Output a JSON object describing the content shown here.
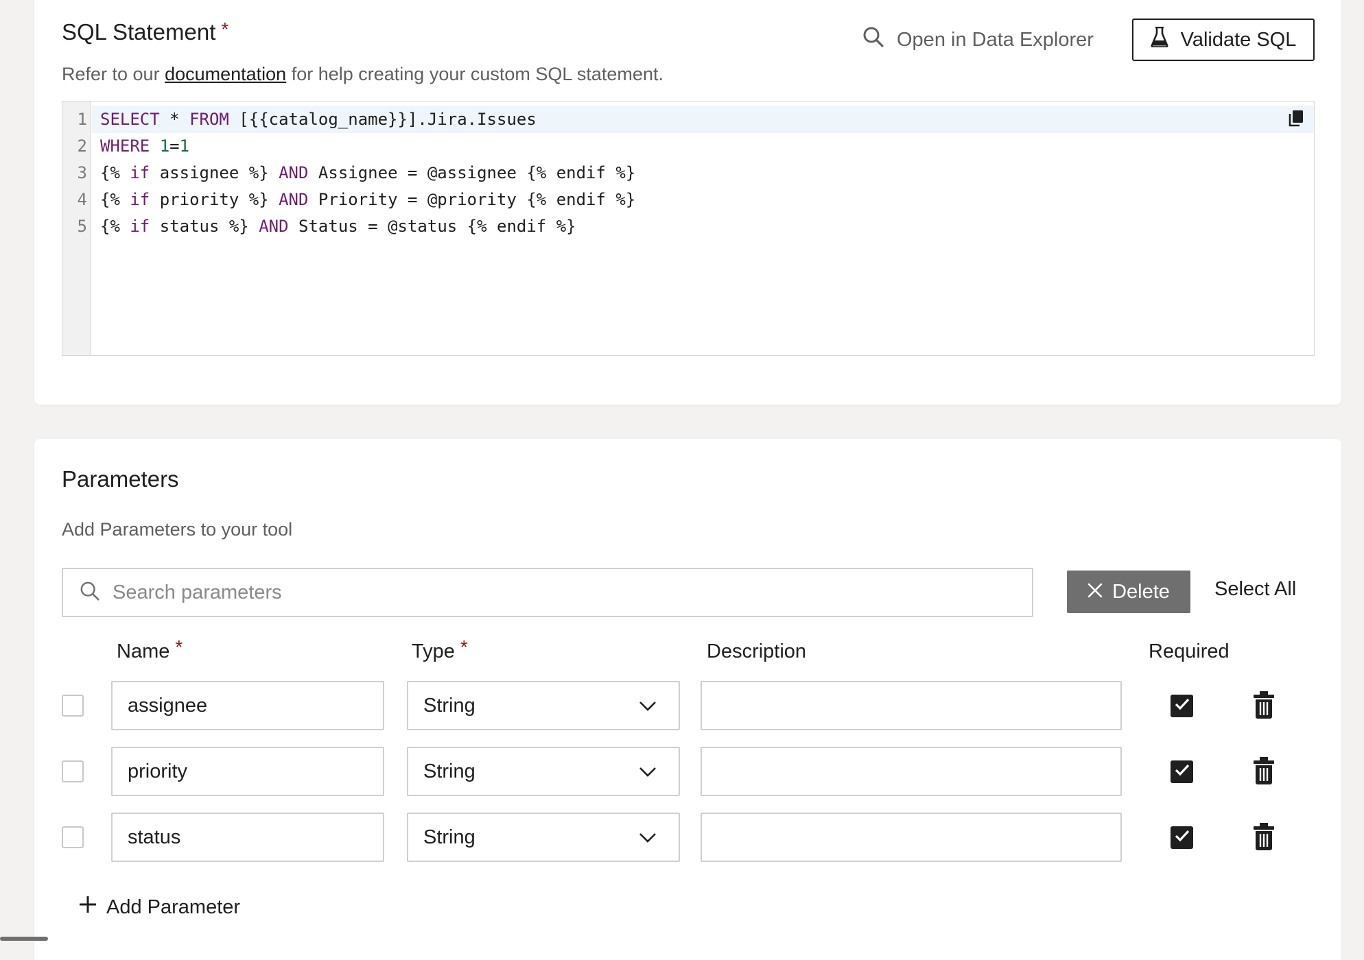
{
  "sql_section": {
    "title": "SQL Statement",
    "required_marker": "*",
    "subtitle_prefix": "Refer to our ",
    "subtitle_link": "documentation",
    "subtitle_suffix": " for help creating your custom SQL statement.",
    "open_explorer_label": "Open in Data Explorer",
    "validate_label": "Validate SQL",
    "line_numbers": [
      "1",
      "2",
      "3",
      "4",
      "5"
    ],
    "code_lines": [
      "SELECT * FROM [{{catalog_name}}].Jira.Issues",
      "WHERE 1=1",
      "{% if assignee %} AND Assignee = @assignee {% endif %}",
      "{% if priority %} AND Priority = @priority {% endif %}",
      "{% if status %} AND Status = @status {% endif %}"
    ]
  },
  "params_section": {
    "title": "Parameters",
    "subtitle": "Add Parameters to your tool",
    "search_placeholder": "Search parameters",
    "delete_label": "Delete",
    "select_all_label": "Select All",
    "columns": {
      "name": "Name",
      "type": "Type",
      "description": "Description",
      "required": "Required",
      "required_marker": "*"
    },
    "rows": [
      {
        "name": "assignee",
        "type": "String",
        "description": "",
        "required": true,
        "selected": false
      },
      {
        "name": "priority",
        "type": "String",
        "description": "",
        "required": true,
        "selected": false
      },
      {
        "name": "status",
        "type": "String",
        "description": "",
        "required": true,
        "selected": false
      }
    ],
    "add_label": "Add Parameter"
  },
  "colors": {
    "accent_required": "#8b1a1a",
    "delete_bg": "#6f6f6f",
    "keyword": "#6f1d6f",
    "number": "#1b6b3a"
  },
  "icons": {
    "search": "search-icon",
    "flask": "flask-icon",
    "copy": "copy-icon",
    "close": "close-icon",
    "chevron": "chevron-down-icon",
    "check": "check-icon",
    "trash": "trash-icon",
    "plus": "plus-icon"
  }
}
